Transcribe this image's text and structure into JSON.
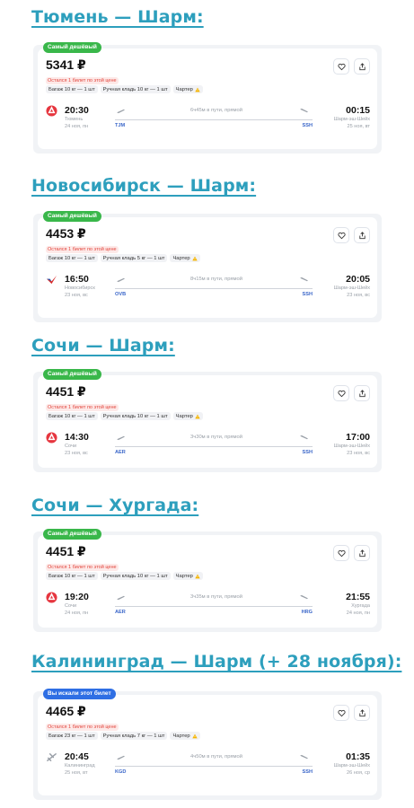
{
  "cards": [
    {
      "route_title": "Тюмень — Шарм:",
      "badge": "Самый дешёвый",
      "badge_color": "#39b74a",
      "price": "5341 ₽",
      "warning": "Остался 1 билет по этой цене",
      "tags": [
        "Багаж 10 кг — 1 шт",
        "Ручная кладь 10 кг — 1 шт",
        "Чартер"
      ],
      "airline_icon": "red-airline-logo-icon",
      "departure": {
        "time": "20:30",
        "city": "Тюмень",
        "date": "24 ноя, пн",
        "code": "TJM"
      },
      "duration": "6ч45м в пути, прямой",
      "arrival": {
        "time": "00:15",
        "city": "Шарм-эш-Шейх",
        "date": "25 ноя, вт",
        "code": "SSH"
      }
    },
    {
      "route_title": "Новосибирск — Шарм:",
      "badge": "Самый дешёвый",
      "badge_color": "#39b74a",
      "price": "4453 ₽",
      "warning": "Остался 1 билет по этой цене",
      "tags": [
        "Багаж 10 кг — 1 шт",
        "Ручная кладь 5 кг — 1 шт",
        "Чартер"
      ],
      "airline_icon": "blue-red-wing-logo-icon",
      "departure": {
        "time": "16:50",
        "city": "Новосибирск",
        "date": "23 ноя, вс",
        "code": "OVB"
      },
      "duration": "8ч15м в пути, прямой",
      "arrival": {
        "time": "20:05",
        "city": "Шарм-эш-Шейх",
        "date": "23 ноя, вс",
        "code": "SSH"
      }
    },
    {
      "route_title": "Сочи — Шарм:",
      "badge": "Самый дешёвый",
      "badge_color": "#39b74a",
      "price": "4451 ₽",
      "warning": "Остался 1 билет по этой цене",
      "tags": [
        "Багаж 10 кг — 1 шт",
        "Ручная кладь 10 кг — 1 шт",
        "Чартер"
      ],
      "airline_icon": "red-airline-logo-icon",
      "departure": {
        "time": "14:30",
        "city": "Сочи",
        "date": "23 ноя, вс",
        "code": "AER"
      },
      "duration": "3ч30м в пути, прямой",
      "arrival": {
        "time": "17:00",
        "city": "Шарм-эш-Шейх",
        "date": "23 ноя, вс",
        "code": "SSH"
      }
    },
    {
      "route_title": "Сочи — Хургада:",
      "badge": "Самый дешёвый",
      "badge_color": "#39b74a",
      "price": "4451 ₽",
      "warning": "Остался 1 билет по этой цене",
      "tags": [
        "Багаж 10 кг — 1 шт",
        "Ручная кладь 10 кг — 1 шт",
        "Чартер"
      ],
      "airline_icon": "red-airline-logo-icon",
      "departure": {
        "time": "19:20",
        "city": "Сочи",
        "date": "24 ноя, пн",
        "code": "AER"
      },
      "duration": "3ч35м в пути, прямой",
      "arrival": {
        "time": "21:55",
        "city": "Хургада",
        "date": "24 ноя, пн",
        "code": "HRG"
      }
    },
    {
      "route_title": "Калининград — Шарм (+ 28 ноября):",
      "badge": "Вы искали этот билет",
      "badge_color": "#2f6fe4",
      "price": "4465 ₽",
      "warning": "Остался 1 билет по этой цене",
      "tags": [
        "Багаж 23 кг — 1 шт",
        "Ручная кладь 7 кг — 1 шт",
        "Чартер"
      ],
      "airline_icon": "grey-plane-icon",
      "departure": {
        "time": "20:45",
        "city": "Калининград",
        "date": "25 ноя, вт",
        "code": "KGD"
      },
      "duration": "4ч50м в пути, прямой",
      "arrival": {
        "time": "01:35",
        "city": "Шарм-эш-Шейх",
        "date": "26 ноя, ср",
        "code": "SSH"
      }
    }
  ]
}
